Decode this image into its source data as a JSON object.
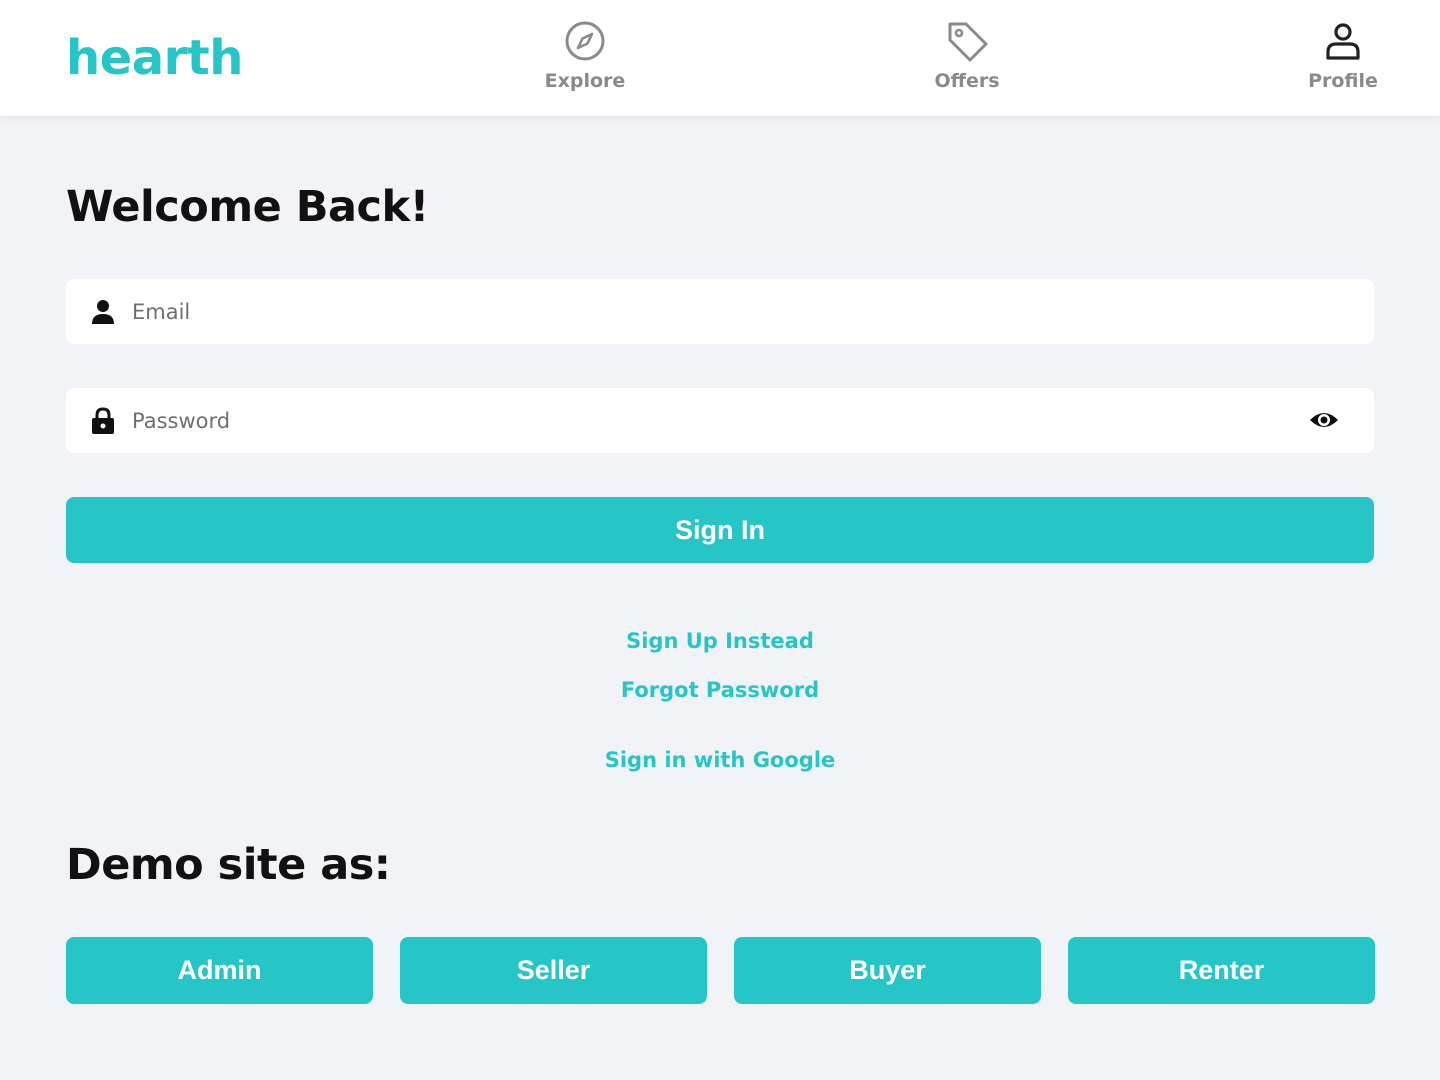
{
  "colors": {
    "accent": "#27c6c6",
    "nav_icon": "#8a8a8a",
    "profile_icon": "#222222",
    "background": "#f2f3f7"
  },
  "header": {
    "logo": "hearth",
    "nav": [
      {
        "label": "Explore",
        "icon": "compass-icon"
      },
      {
        "label": "Offers",
        "icon": "tag-icon"
      },
      {
        "label": "Profile",
        "icon": "user-icon"
      }
    ]
  },
  "login": {
    "title": "Welcome Back!",
    "email": {
      "placeholder": "Email",
      "value": "",
      "icon": "person-icon"
    },
    "password": {
      "placeholder": "Password",
      "value": "",
      "icon": "lock-icon",
      "toggle_icon": "eye-icon"
    },
    "submit_label": "Sign In",
    "links": {
      "signup": "Sign Up Instead",
      "forgot": "Forgot Password",
      "google": "Sign in with Google"
    }
  },
  "demo": {
    "title": "Demo site as:",
    "buttons": [
      "Admin",
      "Seller",
      "Buyer",
      "Renter"
    ]
  }
}
